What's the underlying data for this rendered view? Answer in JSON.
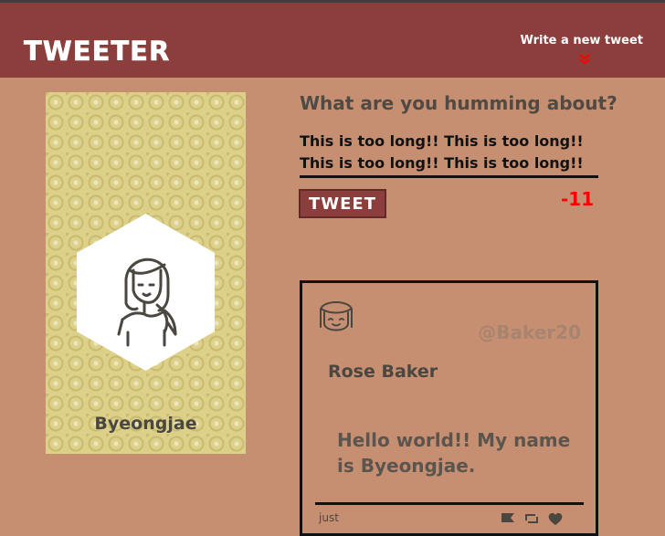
{
  "nav": {
    "brand": "TWEETER",
    "write_link": "Write a new tweet",
    "write_icon": "double-chevron-down-icon",
    "accent_color": "#ff0000"
  },
  "profile": {
    "name": "Byeongjae",
    "avatar_icon": "girl-avatar-icon"
  },
  "compose": {
    "title": "What are you humming about?",
    "text": "This is too long!! This is too long!!\nThis is too long!! This is too long!!",
    "button_label": "TWEET",
    "counter": "-11"
  },
  "tweet": {
    "handle": "@Baker20",
    "author": "Rose Baker",
    "content": "Hello world!! My name is Byeongjae.",
    "time": "just",
    "action_icons": [
      "flag-icon",
      "retweet-icon",
      "heart-icon"
    ]
  },
  "colors": {
    "background": "#c78f71",
    "header": "#8b3e3b",
    "profile_panel": "#ddd18a"
  }
}
